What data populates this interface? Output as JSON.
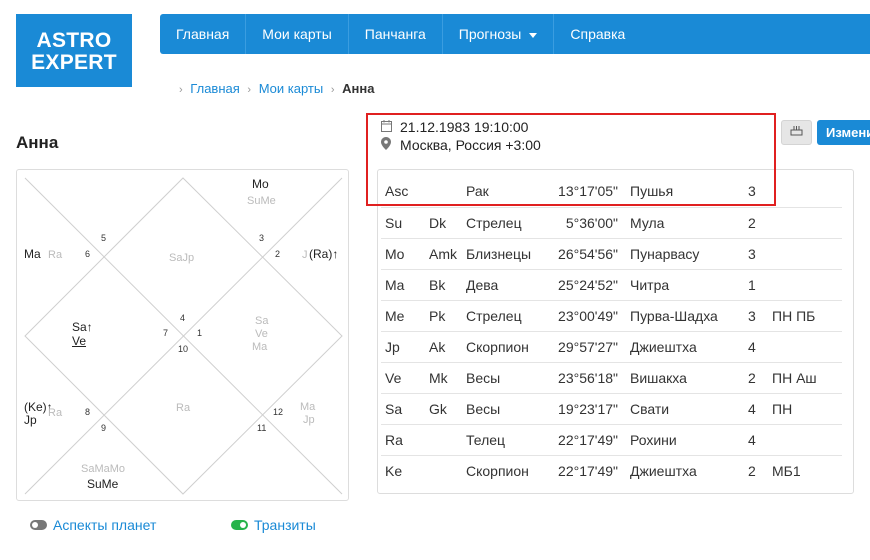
{
  "logo": {
    "line1": "ASTRO",
    "line2": "EXPERT"
  },
  "nav": {
    "items": [
      "Главная",
      "Мои карты",
      "Панчанга",
      "Прогнозы",
      "Справка"
    ]
  },
  "breadcrumb": {
    "items": [
      "Главная",
      "Мои карты"
    ],
    "current": "Анна"
  },
  "page": {
    "title": "Анна"
  },
  "birth": {
    "datetime": "21.12.1983 19:10:00",
    "place": "Москва, Россия +3:00"
  },
  "buttons": {
    "edit": "Изменить"
  },
  "chart": {
    "house_numbers": [
      "1",
      "2",
      "3",
      "4",
      "5",
      "6",
      "7",
      "8",
      "9",
      "10",
      "11",
      "12"
    ],
    "labels": {
      "h10_main": "Mo",
      "h10_dim": "SuMe",
      "h6_main": "Ma",
      "h6_dim": "Ra",
      "h4_dim": "SaJp",
      "h2_main": "(Ra)↑",
      "h2_dim": "J",
      "h7_line1": "Sa↑",
      "h7_line2": "Ve",
      "h1_dim1": "Sa",
      "h1_dim2": "Ve",
      "h1_dim3": "Ma",
      "h10b_dim": "Ra",
      "h8_main1": "(Ke)↑",
      "h8_main2": "Jp",
      "h8_dim": "Ra",
      "h12_dim1": "Ma",
      "h12_dim2": "Jp",
      "h11_dim": "SaMaMo",
      "h11_main": "SuMe"
    }
  },
  "planets": [
    {
      "planet": "Asc",
      "karaka": "",
      "sign": "Рак",
      "degree": "13°17'05\"",
      "nakshatra": "Пушья",
      "pada": "3",
      "note": ""
    },
    {
      "planet": "Su",
      "karaka": "Dk",
      "sign": "Стрелец",
      "degree": "5°36'00\"",
      "nakshatra": "Мула",
      "pada": "2",
      "note": ""
    },
    {
      "planet": "Mo",
      "karaka": "Amk",
      "sign": "Близнецы",
      "degree": "26°54'56\"",
      "nakshatra": "Пунарвасу",
      "pada": "3",
      "note": ""
    },
    {
      "planet": "Ma",
      "karaka": "Bk",
      "sign": "Дева",
      "degree": "25°24'52\"",
      "nakshatra": "Читра",
      "pada": "1",
      "note": ""
    },
    {
      "planet": "Me",
      "karaka": "Pk",
      "sign": "Стрелец",
      "degree": "23°00'49\"",
      "nakshatra": "Пурва-Шадха",
      "pada": "3",
      "note": "ПН ПБ"
    },
    {
      "planet": "Jp",
      "karaka": "Ak",
      "sign": "Скорпион",
      "degree": "29°57'27\"",
      "nakshatra": "Джиештха",
      "pada": "4",
      "note": ""
    },
    {
      "planet": "Ve",
      "karaka": "Mk",
      "sign": "Весы",
      "degree": "23°56'18\"",
      "nakshatra": "Вишакха",
      "pada": "2",
      "note": "ПН Аш"
    },
    {
      "planet": "Sa",
      "karaka": "Gk",
      "sign": "Весы",
      "degree": "19°23'17\"",
      "nakshatra": "Свати",
      "pada": "4",
      "note": "ПН"
    },
    {
      "planet": "Ra",
      "karaka": "",
      "sign": "Телец",
      "degree": "22°17'49\"",
      "nakshatra": "Рохини",
      "pada": "4",
      "note": ""
    },
    {
      "planet": "Ke",
      "karaka": "",
      "sign": "Скорпион",
      "degree": "22°17'49\"",
      "nakshatra": "Джиештха",
      "pada": "2",
      "note": "МБ1"
    }
  ],
  "footer": {
    "aspects": "Аспекты планет",
    "transits": "Транзиты"
  },
  "colors": {
    "brand": "#1a8ad6",
    "highlight": "#e02020",
    "toggle_on": "#26b34a"
  }
}
